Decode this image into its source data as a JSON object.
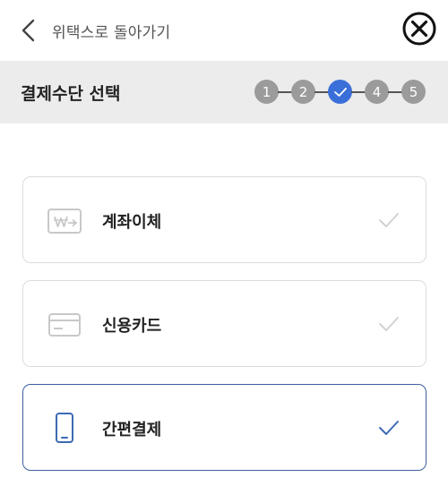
{
  "nav": {
    "back_label": "위택스로 돌아가기"
  },
  "header": {
    "title": "결제수단 선택",
    "steps": [
      {
        "label": "1",
        "state": "default"
      },
      {
        "label": "2",
        "state": "default"
      },
      {
        "label": "",
        "state": "active"
      },
      {
        "label": "4",
        "state": "default"
      },
      {
        "label": "5",
        "state": "default"
      }
    ]
  },
  "payment_methods": [
    {
      "label": "계좌이체",
      "icon": "won-transfer-icon",
      "selected": false
    },
    {
      "label": "신용카드",
      "icon": "credit-card-icon",
      "selected": false
    },
    {
      "label": "간편결제",
      "icon": "mobile-phone-icon",
      "selected": true
    }
  ],
  "colors": {
    "accent": "#3a6fd9",
    "selected_border": "#3d5f9e",
    "selected_icon": "#3d6ab4",
    "muted": "#c8c8c8",
    "header_bg": "#ececec",
    "step_gray": "#9b9b9b"
  }
}
